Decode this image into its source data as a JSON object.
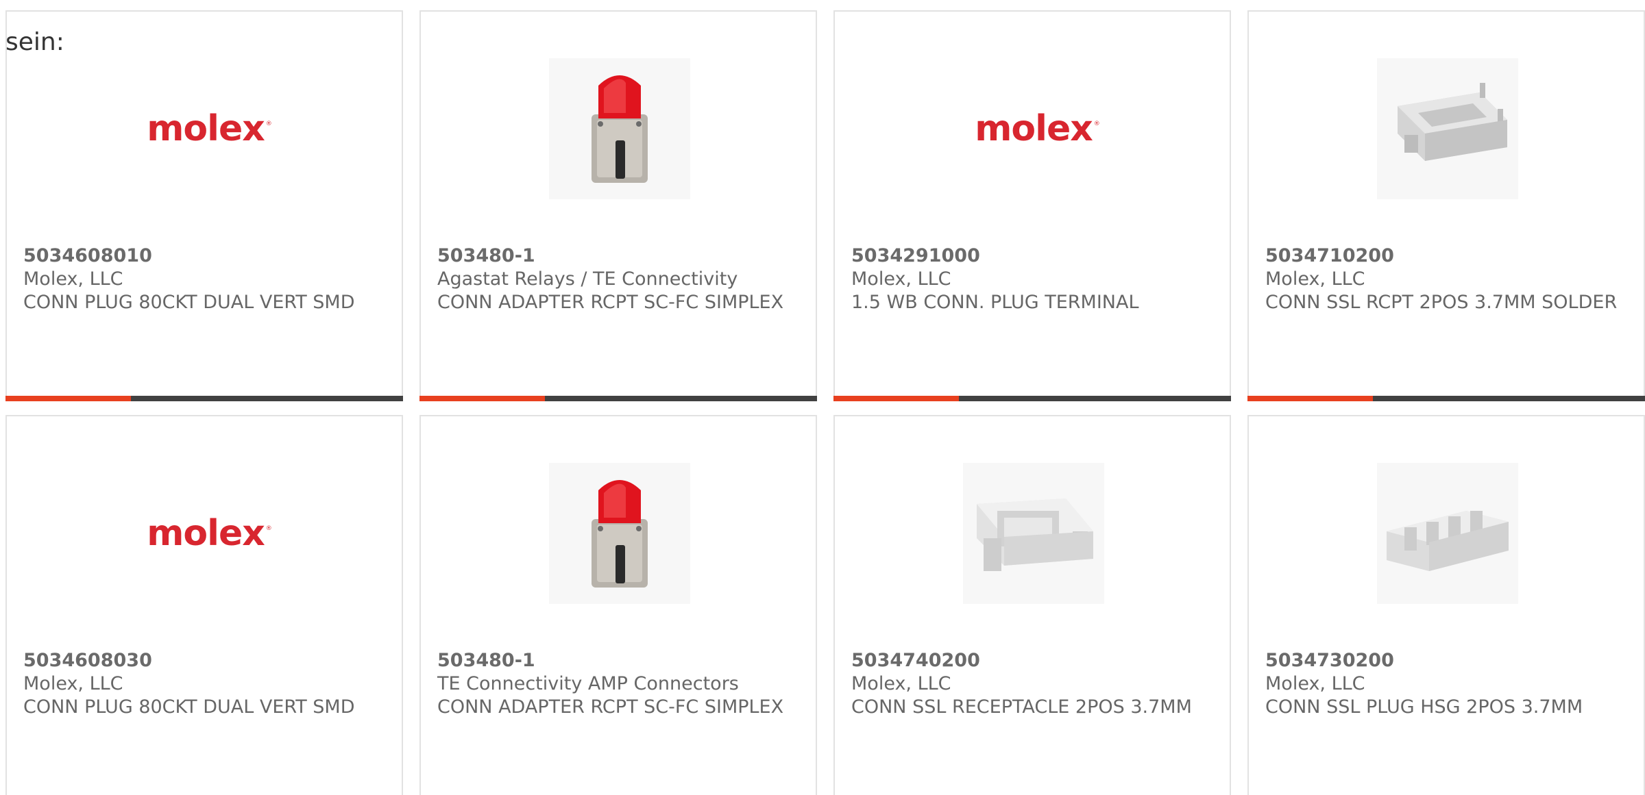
{
  "intro_text": "sein:",
  "colors": {
    "border": "#e2e2e2",
    "text": "#666666",
    "bar_dark": "#414141",
    "bar_accent": "#e8401f",
    "logo_red": "#d8262f"
  },
  "products": [
    {
      "part_number": "5034608010",
      "manufacturer": "Molex, LLC",
      "description": "CONN PLUG 80CKT DUAL VERT SMD",
      "image": "molex-logo",
      "logo_text": "molex"
    },
    {
      "part_number": "503480-1",
      "manufacturer": "Agastat Relays / TE Connectivity",
      "description": "CONN ADAPTER RCPT SC-FC SIMPLEX",
      "image": "fiber-adapter-photo"
    },
    {
      "part_number": "5034291000",
      "manufacturer": "Molex, LLC",
      "description": "1.5 WB CONN. PLUG TERMINAL",
      "image": "molex-logo",
      "logo_text": "molex"
    },
    {
      "part_number": "5034710200",
      "manufacturer": "Molex, LLC",
      "description": "CONN SSL RCPT 2POS 3.7MM SOLDER",
      "image": "connector-receptacle-photo"
    },
    {
      "part_number": "5034608030",
      "manufacturer": "Molex, LLC",
      "description": "CONN PLUG 80CKT DUAL VERT SMD",
      "image": "molex-logo",
      "logo_text": "molex"
    },
    {
      "part_number": "503480-1",
      "manufacturer": "TE Connectivity AMP Connectors",
      "description": "CONN ADAPTER RCPT SC-FC SIMPLEX",
      "image": "fiber-adapter-photo"
    },
    {
      "part_number": "5034740200",
      "manufacturer": "Molex, LLC",
      "description": "CONN SSL RECEPTACLE 2POS 3.7MM",
      "image": "connector-receptacle-photo"
    },
    {
      "part_number": "5034730200",
      "manufacturer": "Molex, LLC",
      "description": "CONN SSL PLUG HSG 2POS 3.7MM",
      "image": "connector-plug-housing-photo"
    }
  ]
}
